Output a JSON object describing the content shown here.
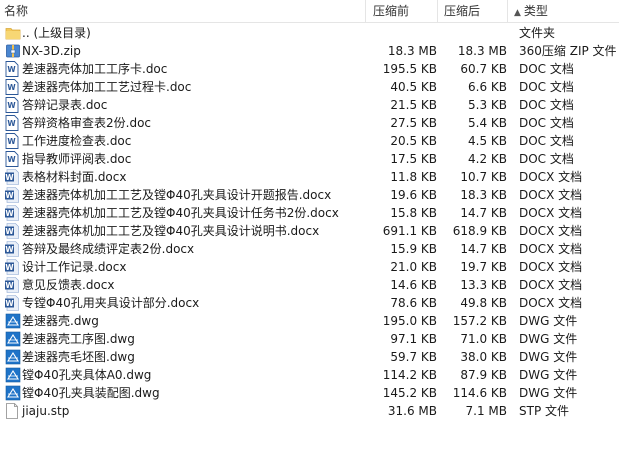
{
  "header": {
    "name": "名称",
    "original_size": "压缩前",
    "compressed_size": "压缩后",
    "type_sort_arrow": "▲",
    "type": "类型"
  },
  "files": [
    {
      "name": ".. (上级目录)",
      "original": "",
      "compressed": "",
      "type": "文件夹",
      "icon": "folder-icon"
    },
    {
      "name": "NX-3D.zip",
      "original": "18.3 MB",
      "compressed": "18.3 MB",
      "type": "360压缩 ZIP 文件",
      "icon": "zip-icon"
    },
    {
      "name": "差速器壳体加工工序卡.doc",
      "original": "195.5 KB",
      "compressed": "60.7 KB",
      "type": "DOC 文档",
      "icon": "word-doc-icon"
    },
    {
      "name": "差速器壳体加工工艺过程卡.doc",
      "original": "40.5 KB",
      "compressed": "6.6 KB",
      "type": "DOC 文档",
      "icon": "word-doc-icon"
    },
    {
      "name": "答辩记录表.doc",
      "original": "21.5 KB",
      "compressed": "5.3 KB",
      "type": "DOC 文档",
      "icon": "word-doc-icon"
    },
    {
      "name": "答辩资格审查表2份.doc",
      "original": "27.5 KB",
      "compressed": "5.4 KB",
      "type": "DOC 文档",
      "icon": "word-doc-icon"
    },
    {
      "name": "工作进度检查表.doc",
      "original": "20.5 KB",
      "compressed": "4.5 KB",
      "type": "DOC 文档",
      "icon": "word-doc-icon"
    },
    {
      "name": "指导教师评阅表.doc",
      "original": "17.5 KB",
      "compressed": "4.2 KB",
      "type": "DOC 文档",
      "icon": "word-doc-icon"
    },
    {
      "name": "表格材料封面.docx",
      "original": "11.8 KB",
      "compressed": "10.7 KB",
      "type": "DOCX 文档",
      "icon": "word-docx-icon"
    },
    {
      "name": "差速器壳体机加工工艺及镗Φ40孔夹具设计开题报告.docx",
      "original": "19.6 KB",
      "compressed": "18.3 KB",
      "type": "DOCX 文档",
      "icon": "word-docx-icon"
    },
    {
      "name": "差速器壳体机加工工艺及镗Φ40孔夹具设计任务书2份.docx",
      "original": "15.8 KB",
      "compressed": "14.7 KB",
      "type": "DOCX 文档",
      "icon": "word-docx-icon"
    },
    {
      "name": "差速器壳体机加工工艺及镗Φ40孔夹具设计说明书.docx",
      "original": "691.1 KB",
      "compressed": "618.9 KB",
      "type": "DOCX 文档",
      "icon": "word-docx-icon"
    },
    {
      "name": "答辩及最终成绩评定表2份.docx",
      "original": "15.9 KB",
      "compressed": "14.7 KB",
      "type": "DOCX 文档",
      "icon": "word-docx-icon"
    },
    {
      "name": "设计工作记录.docx",
      "original": "21.0 KB",
      "compressed": "19.7 KB",
      "type": "DOCX 文档",
      "icon": "word-docx-icon"
    },
    {
      "name": "意见反馈表.docx",
      "original": "14.6 KB",
      "compressed": "13.3 KB",
      "type": "DOCX 文档",
      "icon": "word-docx-icon"
    },
    {
      "name": "专镗Φ40孔用夹具设计部分.docx",
      "original": "78.6 KB",
      "compressed": "49.8 KB",
      "type": "DOCX 文档",
      "icon": "word-docx-icon"
    },
    {
      "name": "差速器壳.dwg",
      "original": "195.0 KB",
      "compressed": "157.2 KB",
      "type": "DWG 文件",
      "icon": "dwg-icon"
    },
    {
      "name": "差速器壳工序图.dwg",
      "original": "97.1 KB",
      "compressed": "71.0 KB",
      "type": "DWG 文件",
      "icon": "dwg-icon"
    },
    {
      "name": "差速器壳毛坯图.dwg",
      "original": "59.7 KB",
      "compressed": "38.0 KB",
      "type": "DWG 文件",
      "icon": "dwg-icon"
    },
    {
      "name": "镗Φ40孔夹具体A0.dwg",
      "original": "114.2 KB",
      "compressed": "87.9 KB",
      "type": "DWG 文件",
      "icon": "dwg-icon"
    },
    {
      "name": "镗Φ40孔夹具装配图.dwg",
      "original": "145.2 KB",
      "compressed": "114.6 KB",
      "type": "DWG 文件",
      "icon": "dwg-icon"
    },
    {
      "name": "jiaju.stp",
      "original": "31.6 MB",
      "compressed": "7.1 MB",
      "type": "STP 文件",
      "icon": "stp-file-icon"
    }
  ],
  "colors": {
    "folder": "#f3c85a",
    "word_blue": "#2b5797",
    "dwg_blue": "#1e73c8",
    "zip_blue": "#3a78c8"
  }
}
